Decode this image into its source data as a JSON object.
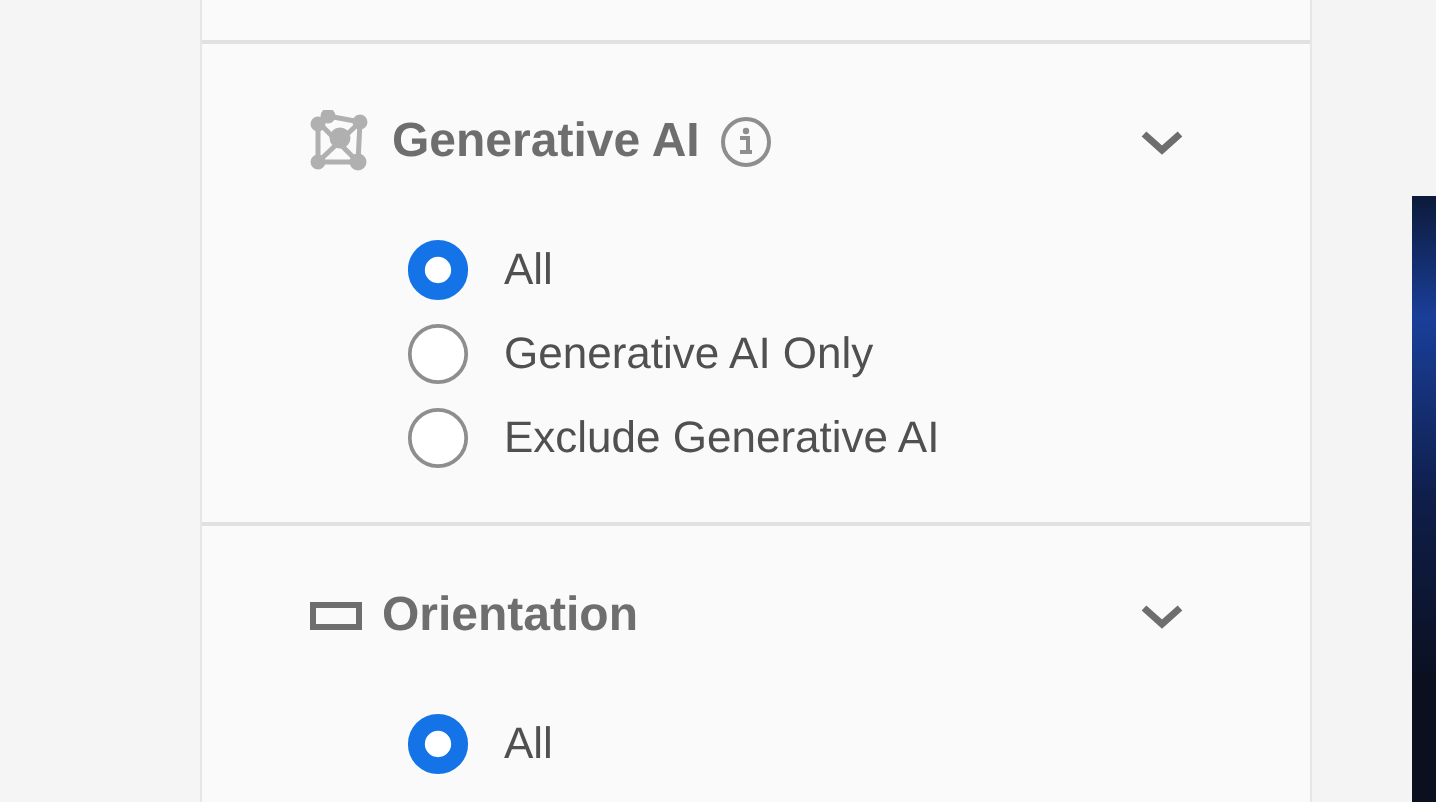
{
  "filters": [
    {
      "kind": "generative",
      "title": "Generative AI",
      "info": true,
      "expanded": true,
      "options": [
        {
          "label": "All",
          "selected": true
        },
        {
          "label": "Generative AI Only",
          "selected": false
        },
        {
          "label": "Exclude Generative AI",
          "selected": false
        }
      ]
    },
    {
      "kind": "orientation",
      "title": "Orientation",
      "info": false,
      "expanded": true,
      "options": [
        {
          "label": "All",
          "selected": true
        }
      ]
    }
  ]
}
